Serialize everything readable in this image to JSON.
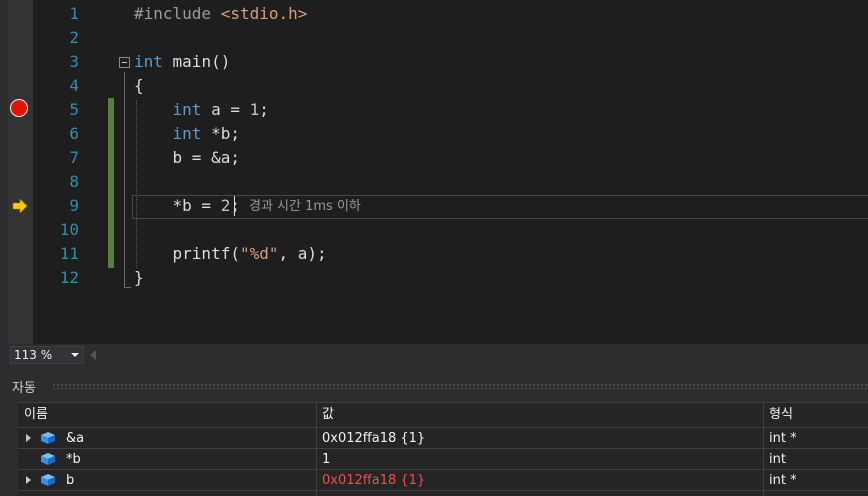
{
  "editor": {
    "line_numbers": [
      "1",
      "2",
      "3",
      "4",
      "5",
      "6",
      "7",
      "8",
      "9",
      "10",
      "11",
      "12"
    ],
    "lines": [
      [
        {
          "t": "#include ",
          "c": "inc"
        },
        {
          "t": "<stdio.h>",
          "c": "str"
        }
      ],
      [],
      [
        {
          "t": "int",
          "c": "kw"
        },
        {
          "t": " main()",
          "c": "plain"
        }
      ],
      [
        {
          "t": "{",
          "c": "plain"
        }
      ],
      [
        {
          "t": "    ",
          "c": "plain"
        },
        {
          "t": "int",
          "c": "kw"
        },
        {
          "t": " a = ",
          "c": "plain"
        },
        {
          "t": "1",
          "c": "num"
        },
        {
          "t": ";",
          "c": "plain"
        }
      ],
      [
        {
          "t": "    ",
          "c": "plain"
        },
        {
          "t": "int",
          "c": "kw"
        },
        {
          "t": " *b;",
          "c": "plain"
        }
      ],
      [
        {
          "t": "    b = &a;",
          "c": "plain"
        }
      ],
      [],
      [
        {
          "t": "    *b = ",
          "c": "plain"
        },
        {
          "t": "2",
          "c": "num"
        },
        {
          "t": ";",
          "c": "plain"
        }
      ],
      [],
      [
        {
          "t": "    printf(",
          "c": "plain"
        },
        {
          "t": "\"%d\"",
          "c": "str"
        },
        {
          "t": ", a);",
          "c": "plain"
        }
      ],
      [
        {
          "t": "}",
          "c": "plain"
        }
      ]
    ],
    "perf_tip": "경과 시간 1ms 이하",
    "breakpoint_line": 5,
    "current_line": 9
  },
  "statusbar": {
    "zoom": "113 %"
  },
  "autos": {
    "title": "자동",
    "columns": [
      "이름",
      "값",
      "형식"
    ],
    "rows": [
      {
        "name": "&a",
        "value": "0x012ffa18 {1}",
        "type": "int *",
        "expandable": true,
        "changed": false
      },
      {
        "name": "*b",
        "value": "1",
        "type": "int",
        "expandable": false,
        "changed": false
      },
      {
        "name": "b",
        "value": "0x012ffa18 {1}",
        "type": "int *",
        "expandable": true,
        "changed": true
      }
    ]
  },
  "colors": {
    "keyword": "#569cd6",
    "string": "#d69d85",
    "number": "#b5cea8",
    "line_number": "#2b91af",
    "breakpoint": "#e51400",
    "instruction_pointer": "#ffcc00",
    "changed_value": "#ef4e4e",
    "change_bar": "#57813a"
  }
}
